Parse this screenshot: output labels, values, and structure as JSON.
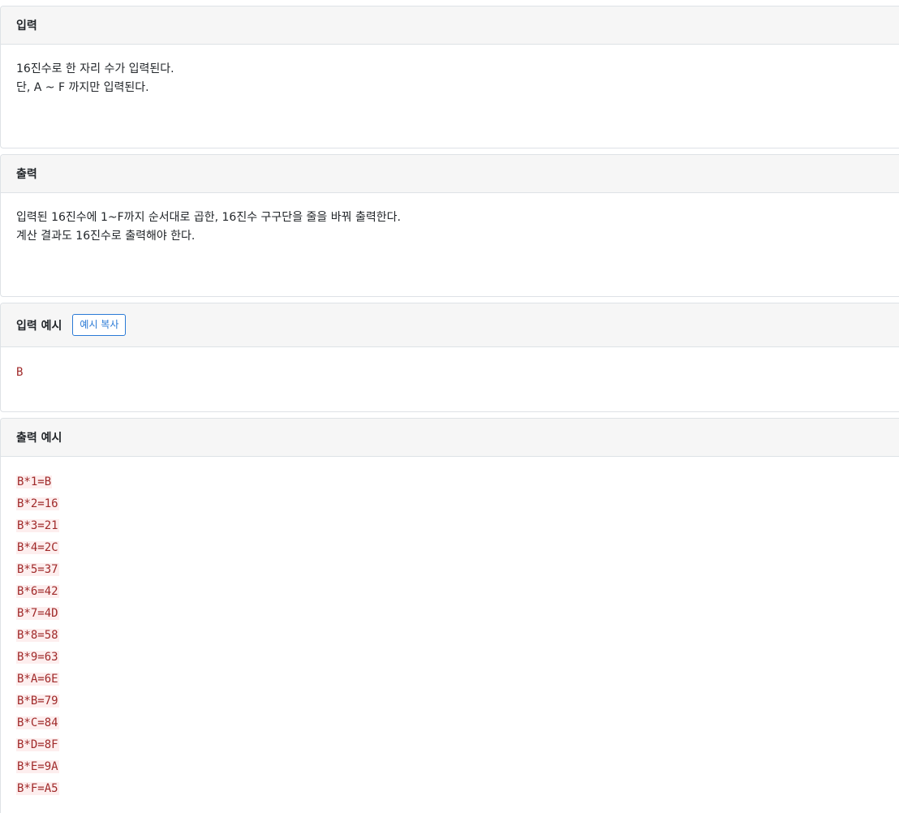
{
  "input_section": {
    "title": "입력",
    "lines": [
      "16진수로 한 자리 수가 입력된다.",
      "단, A ~ F 까지만 입력된다."
    ]
  },
  "output_section": {
    "title": "출력",
    "lines": [
      "입력된 16진수에 1~F까지 순서대로 곱한, 16진수 구구단을 줄을 바꿔 출력한다.",
      "계산 결과도 16진수로 출력해야 한다."
    ]
  },
  "input_example": {
    "title": "입력 예시",
    "copy_button": "예시 복사",
    "value": "B"
  },
  "output_example": {
    "title": "출력 예시",
    "lines": [
      "B*1=B",
      "B*2=16",
      "B*3=21",
      "B*4=2C",
      "B*5=37",
      "B*6=42",
      "B*7=4D",
      "B*8=58",
      "B*9=63",
      "B*A=6E",
      "B*B=79",
      "B*C=84",
      "B*D=8F",
      "B*E=9A",
      "B*F=A5"
    ]
  }
}
